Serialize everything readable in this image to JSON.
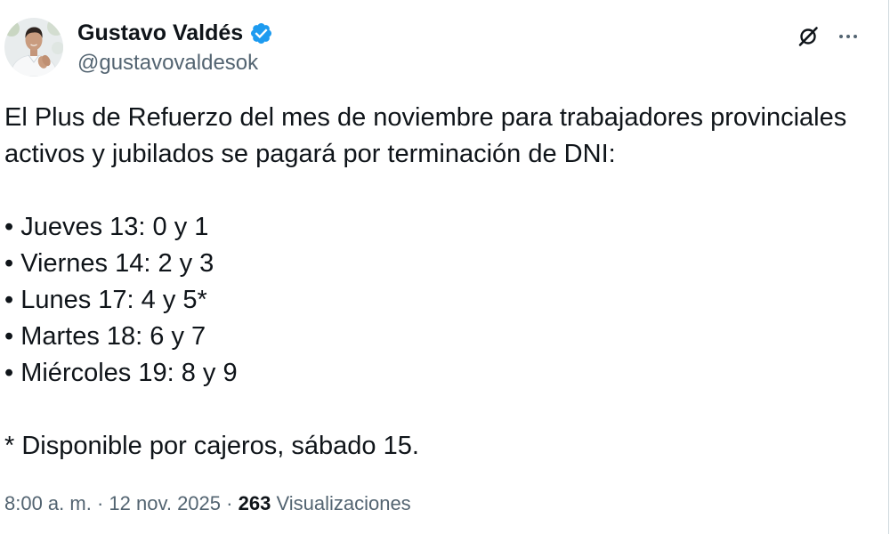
{
  "author": {
    "name": "Gustavo Valdés",
    "handle": "@gustavovaldesok",
    "avatar_icon": "avatar-photo",
    "verified_icon": "verified-badge-icon"
  },
  "header_actions": {
    "grok_icon": "grok-icon",
    "more_icon": "more-icon"
  },
  "post": {
    "intro_lines": [
      "El Plus de Refuerzo del mes de noviembre para trabajadores provinciales",
      "activos y jubilados se pagará por terminación de DNI:"
    ],
    "schedule": [
      "• Jueves 13: 0 y 1",
      "• Viernes 14: 2 y 3",
      "• Lunes 17: 4 y 5*",
      "• Martes 18: 6 y 7",
      "• Miércoles 19: 8 y 9"
    ],
    "note": "* Disponible por cajeros, sábado 15."
  },
  "meta": {
    "time": "8:00 a. m.",
    "separator": "·",
    "date": "12 nov. 2025",
    "views_count": "263",
    "views_label": "Visualizaciones"
  },
  "colors": {
    "text": "#0f1419",
    "secondary": "#536471",
    "accent": "#1d9bf0",
    "background": "#ffffff"
  }
}
